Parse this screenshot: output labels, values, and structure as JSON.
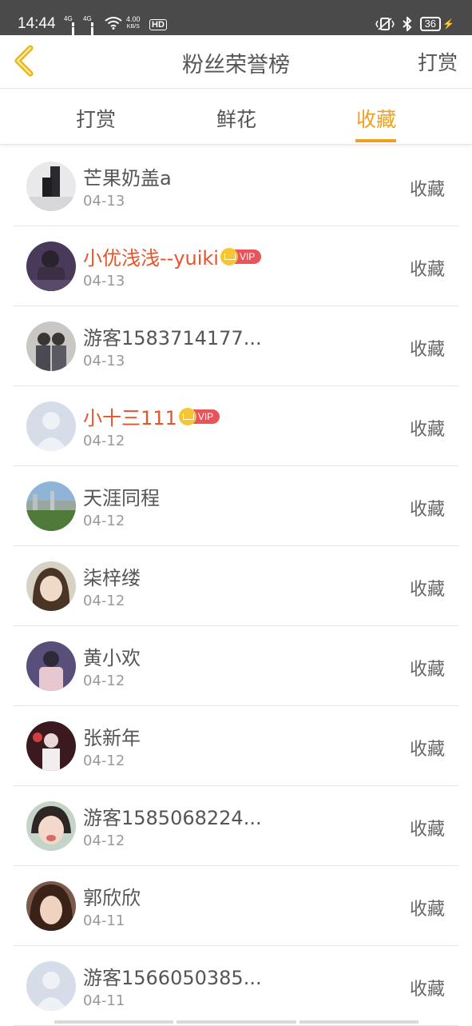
{
  "status_bar": {
    "time": "14:44",
    "network_type_1": "4G",
    "network_type_2": "4G",
    "net_speed_value": "4.00",
    "net_speed_unit": "KB/S",
    "hd_label": "HD",
    "battery": "36"
  },
  "header": {
    "title": "粉丝荣誉榜",
    "right_action": "打赏",
    "back_icon": "chevron-left-icon",
    "accent_color": "#f0a020"
  },
  "tabs": [
    {
      "label": "打赏",
      "active": false
    },
    {
      "label": "鲜花",
      "active": false
    },
    {
      "label": "收藏",
      "active": true
    }
  ],
  "fans": [
    {
      "name": "芒果奶盖a",
      "date": "04-13",
      "action": "收藏",
      "vip": false,
      "avatar": "photo"
    },
    {
      "name": "小优浅浅--yuiki",
      "date": "04-13",
      "action": "收藏",
      "vip": true,
      "vip_label": "VIP",
      "avatar": "photo"
    },
    {
      "name": "游客1583714177...",
      "date": "04-13",
      "action": "收藏",
      "vip": false,
      "avatar": "photo"
    },
    {
      "name": "小十三111",
      "date": "04-12",
      "action": "收藏",
      "vip": true,
      "vip_label": "VIP",
      "avatar": "default"
    },
    {
      "name": "天涯同程",
      "date": "04-12",
      "action": "收藏",
      "vip": false,
      "avatar": "photo"
    },
    {
      "name": "柒梓缕",
      "date": "04-12",
      "action": "收藏",
      "vip": false,
      "avatar": "photo"
    },
    {
      "name": "黄小欢",
      "date": "04-12",
      "action": "收藏",
      "vip": false,
      "avatar": "photo"
    },
    {
      "name": "张新年",
      "date": "04-12",
      "action": "收藏",
      "vip": false,
      "avatar": "photo"
    },
    {
      "name": "游客1585068224...",
      "date": "04-12",
      "action": "收藏",
      "vip": false,
      "avatar": "photo"
    },
    {
      "name": "郭欣欣",
      "date": "04-11",
      "action": "收藏",
      "vip": false,
      "avatar": "photo"
    },
    {
      "name": "游客1566050385...",
      "date": "04-11",
      "action": "收藏",
      "vip": false,
      "avatar": "default"
    }
  ]
}
